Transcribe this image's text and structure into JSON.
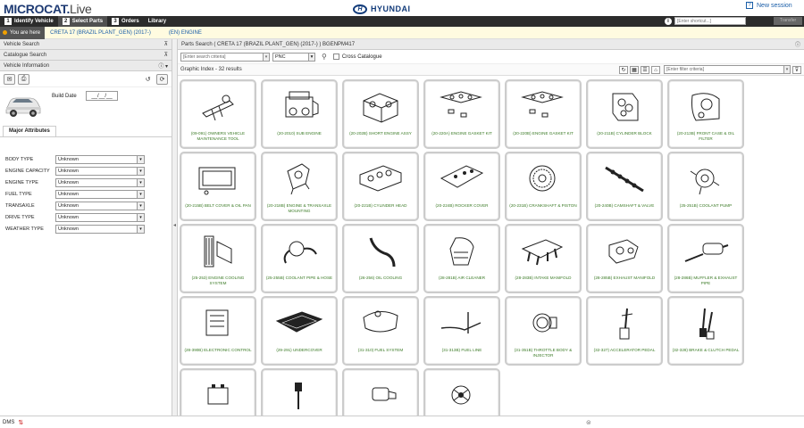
{
  "app": {
    "name": "MICROCAT",
    "sub": "Live",
    "brand": "HYUNDAI",
    "help_link": "New session"
  },
  "tabs": [
    {
      "num": "1",
      "label": "Identify Vehicle"
    },
    {
      "num": "2",
      "label": "Select Parts"
    },
    {
      "num": "3",
      "label": "Orders"
    },
    {
      "num": "",
      "label": "Library"
    }
  ],
  "shortcut": {
    "placeholder": "[Enter shortcut...]",
    "transfer_label": "Transfer"
  },
  "breadcrumb": {
    "here": "You are here",
    "vehicle": "CRETA 17 (BRAZIL PLANT_GEN) (2017-)",
    "section": "(EN) ENGINE"
  },
  "left": {
    "vehicle_search": "Vehicle Search",
    "catalogue_search": "Catalogue Search",
    "vehicle_information": "Vehicle Information",
    "build_date_label": "Build Date",
    "build_date_value": "__/__/__",
    "major_attributes_tab": "Major Attributes",
    "attributes": [
      {
        "label": "BODY TYPE",
        "value": "Unknown"
      },
      {
        "label": "ENGINE CAPACITY",
        "value": "Unknown"
      },
      {
        "label": "ENGINE TYPE",
        "value": "Unknown"
      },
      {
        "label": "FUEL TYPE",
        "value": "Unknown"
      },
      {
        "label": "TRANSAXLE",
        "value": "Unknown"
      },
      {
        "label": "DRIVE TYPE",
        "value": "Unknown"
      },
      {
        "label": "WEATHER TYPE",
        "value": "Unknown"
      }
    ]
  },
  "main": {
    "header": "Parts Search ( CRETA 17 (BRAZIL PLANT_GEN) (2017-) ) BGENPM417",
    "search_placeholder": "[Enter search criteria]",
    "search_type": "PNC",
    "cross_catalogue": "Cross Catalogue",
    "graphic_index": "Graphic Index - 32 results",
    "filter_placeholder": "[Enter filter criteria]"
  },
  "cards": [
    {
      "label": "(09-091) OWNERS VEHICLE MAINTENANCE TOOL",
      "icon": "tool-kit-icon"
    },
    {
      "label": "(20-2010) SUB ENGINE",
      "icon": "engine-icon"
    },
    {
      "label": "(20-202B) SHORT ENGINE ASSY",
      "icon": "engine-block-icon"
    },
    {
      "label": "(20-220A) ENGINE GASKET KIT",
      "icon": "gasket-icon"
    },
    {
      "label": "(20-220B) ENGINE GASKET KIT",
      "icon": "gasket-icon"
    },
    {
      "label": "(20-211B) CYLINDER BLOCK",
      "icon": "cylinder-block-icon"
    },
    {
      "label": "(20-213B) FRONT CASE & OIL FILTER",
      "icon": "front-case-icon"
    },
    {
      "label": "(20-215B) BELT COVER & OIL PAN",
      "icon": "oil-pan-icon"
    },
    {
      "label": "(20-218B) ENGINE & TRANSAXLE MOUNTING",
      "icon": "mounting-icon"
    },
    {
      "label": "(20-221B) CYLINDER HEAD",
      "icon": "cylinder-head-icon"
    },
    {
      "label": "(20-224B) ROCKER COVER",
      "icon": "rocker-cover-icon"
    },
    {
      "label": "(20-231B) CRANKSHAFT & PISTON",
      "icon": "crankshaft-icon"
    },
    {
      "label": "(20-240B) CAMSHAFT & VALVE",
      "icon": "camshaft-icon"
    },
    {
      "label": "(25-251B) COOLANT PUMP",
      "icon": "coolant-pump-icon"
    },
    {
      "label": "(25-253) ENGINE COOLING SYSTEM",
      "icon": "radiator-icon"
    },
    {
      "label": "(25-255B) COOLANT PIPE & HOSE",
      "icon": "coolant-pipe-icon"
    },
    {
      "label": "(26-256) OIL COOLING",
      "icon": "oil-hose-icon"
    },
    {
      "label": "(28-281B) AIR CLEANER",
      "icon": "air-cleaner-icon"
    },
    {
      "label": "(28-283B) INTAKE MANIFOLD",
      "icon": "intake-manifold-icon"
    },
    {
      "label": "(28-285B) EXHAUST MANIFOLD",
      "icon": "exhaust-manifold-icon"
    },
    {
      "label": "(28-286B) MUFFLER & EXHAUST PIPE",
      "icon": "muffler-icon"
    },
    {
      "label": "(28-390B) ELECTRONIC CONTROL",
      "icon": "ecu-icon"
    },
    {
      "label": "(29-291) UNDERCOVER",
      "icon": "undercover-icon"
    },
    {
      "label": "(31-310) FUEL SYSTEM",
      "icon": "fuel-tank-icon"
    },
    {
      "label": "(31-313B) FUEL LINE",
      "icon": "fuel-line-icon"
    },
    {
      "label": "(31-351B) THROTTLE BODY & INJECTOR",
      "icon": "throttle-body-icon"
    },
    {
      "label": "(32-327) ACCELERATOR PEDAL",
      "icon": "accelerator-pedal-icon"
    },
    {
      "label": "(32-328) BRAKE & CLUTCH PEDAL",
      "icon": "brake-pedal-icon"
    },
    {
      "label": "",
      "icon": "battery-icon"
    },
    {
      "label": "",
      "icon": "ignition-coil-icon"
    },
    {
      "label": "",
      "icon": "starter-icon"
    },
    {
      "label": "",
      "icon": "alternator-icon"
    }
  ],
  "status": {
    "left": "DMS"
  }
}
